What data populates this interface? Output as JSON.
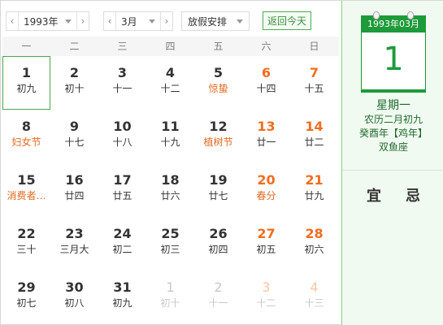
{
  "toolbar": {
    "year_value": "1993年",
    "month_value": "3月",
    "holiday_value": "放假安排",
    "today_label": "返回今天",
    "prev_symbol": "‹",
    "next_symbol": "›"
  },
  "weekdays": [
    "一",
    "二",
    "三",
    "四",
    "五",
    "六",
    "日"
  ],
  "days": [
    {
      "num": "1",
      "sub": "初九",
      "weekend": false,
      "festival": false,
      "other": false,
      "selected": true
    },
    {
      "num": "2",
      "sub": "初十",
      "weekend": false,
      "festival": false,
      "other": false
    },
    {
      "num": "3",
      "sub": "十一",
      "weekend": false,
      "festival": false,
      "other": false
    },
    {
      "num": "4",
      "sub": "十二",
      "weekend": false,
      "festival": false,
      "other": false
    },
    {
      "num": "5",
      "sub": "惊蛰",
      "weekend": false,
      "festival": true,
      "other": false
    },
    {
      "num": "6",
      "sub": "十四",
      "weekend": true,
      "festival": false,
      "other": false
    },
    {
      "num": "7",
      "sub": "十五",
      "weekend": true,
      "festival": false,
      "other": false
    },
    {
      "num": "8",
      "sub": "妇女节",
      "weekend": false,
      "festival": true,
      "other": false
    },
    {
      "num": "9",
      "sub": "十七",
      "weekend": false,
      "festival": false,
      "other": false
    },
    {
      "num": "10",
      "sub": "十八",
      "weekend": false,
      "festival": false,
      "other": false
    },
    {
      "num": "11",
      "sub": "十九",
      "weekend": false,
      "festival": false,
      "other": false
    },
    {
      "num": "12",
      "sub": "植树节",
      "weekend": false,
      "festival": true,
      "other": false
    },
    {
      "num": "13",
      "sub": "廿一",
      "weekend": true,
      "festival": false,
      "other": false
    },
    {
      "num": "14",
      "sub": "廿二",
      "weekend": true,
      "festival": false,
      "other": false
    },
    {
      "num": "15",
      "sub": "消费者…",
      "weekend": false,
      "festival": true,
      "other": false
    },
    {
      "num": "16",
      "sub": "廿四",
      "weekend": false,
      "festival": false,
      "other": false
    },
    {
      "num": "17",
      "sub": "廿五",
      "weekend": false,
      "festival": false,
      "other": false
    },
    {
      "num": "18",
      "sub": "廿六",
      "weekend": false,
      "festival": false,
      "other": false
    },
    {
      "num": "19",
      "sub": "廿七",
      "weekend": false,
      "festival": false,
      "other": false
    },
    {
      "num": "20",
      "sub": "春分",
      "weekend": true,
      "festival": true,
      "other": false
    },
    {
      "num": "21",
      "sub": "廿九",
      "weekend": true,
      "festival": false,
      "other": false
    },
    {
      "num": "22",
      "sub": "三十",
      "weekend": false,
      "festival": false,
      "other": false
    },
    {
      "num": "23",
      "sub": "三月大",
      "weekend": false,
      "festival": false,
      "other": false
    },
    {
      "num": "24",
      "sub": "初二",
      "weekend": false,
      "festival": false,
      "other": false
    },
    {
      "num": "25",
      "sub": "初三",
      "weekend": false,
      "festival": false,
      "other": false
    },
    {
      "num": "26",
      "sub": "初四",
      "weekend": false,
      "festival": false,
      "other": false
    },
    {
      "num": "27",
      "sub": "初五",
      "weekend": true,
      "festival": false,
      "other": false
    },
    {
      "num": "28",
      "sub": "初六",
      "weekend": true,
      "festival": false,
      "other": false
    },
    {
      "num": "29",
      "sub": "初七",
      "weekend": false,
      "festival": false,
      "other": false
    },
    {
      "num": "30",
      "sub": "初八",
      "weekend": false,
      "festival": false,
      "other": false
    },
    {
      "num": "31",
      "sub": "初九",
      "weekend": false,
      "festival": false,
      "other": false
    },
    {
      "num": "1",
      "sub": "初十",
      "weekend": false,
      "festival": false,
      "other": true
    },
    {
      "num": "2",
      "sub": "十一",
      "weekend": false,
      "festival": false,
      "other": true
    },
    {
      "num": "3",
      "sub": "十二",
      "weekend": true,
      "festival": false,
      "other": true
    },
    {
      "num": "4",
      "sub": "十三",
      "weekend": true,
      "festival": false,
      "other": true
    }
  ],
  "panel": {
    "date_header": "1993年03月",
    "big_day": "1",
    "weekday": "星期一",
    "lunar": "农历二月初九",
    "ganzhi": "癸酉年【鸡年】",
    "zodiac": "双鱼座",
    "yi": "宜",
    "ji": "忌"
  },
  "colors": {
    "accent_green": "#1e9a3a",
    "weekend_orange": "#f26d1f",
    "festival_orange": "#e3691f"
  }
}
